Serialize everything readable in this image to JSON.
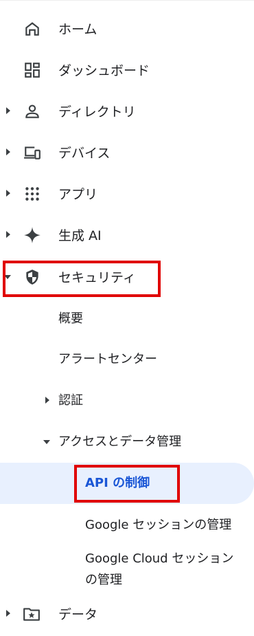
{
  "nav": {
    "home": "ホーム",
    "dashboard": "ダッシュボード",
    "directory": "ディレクトリ",
    "devices": "デバイス",
    "apps": "アプリ",
    "genai": "生成 AI",
    "security": "セキュリティ",
    "data": "データ"
  },
  "security_sub": {
    "overview": "概要",
    "alert_center": "アラートセンター",
    "authentication": "認証",
    "access_data_control": "アクセスとデータ管理",
    "api_controls": "API の制御",
    "google_session_control": "Google セッションの管理",
    "google_cloud_session_line1": "Google Cloud セッション",
    "google_cloud_session_line2": "の管理"
  },
  "icons": {
    "home": "home-icon",
    "dashboard": "dashboard-icon",
    "directory": "person-icon",
    "devices": "devices-icon",
    "apps": "apps-grid-icon",
    "genai": "sparkle-icon",
    "security": "shield-icon",
    "data": "folder-star-icon"
  },
  "colors": {
    "selected_text": "#1a56d6",
    "selected_bg": "#e8f0fe",
    "highlight": "#e00000"
  }
}
